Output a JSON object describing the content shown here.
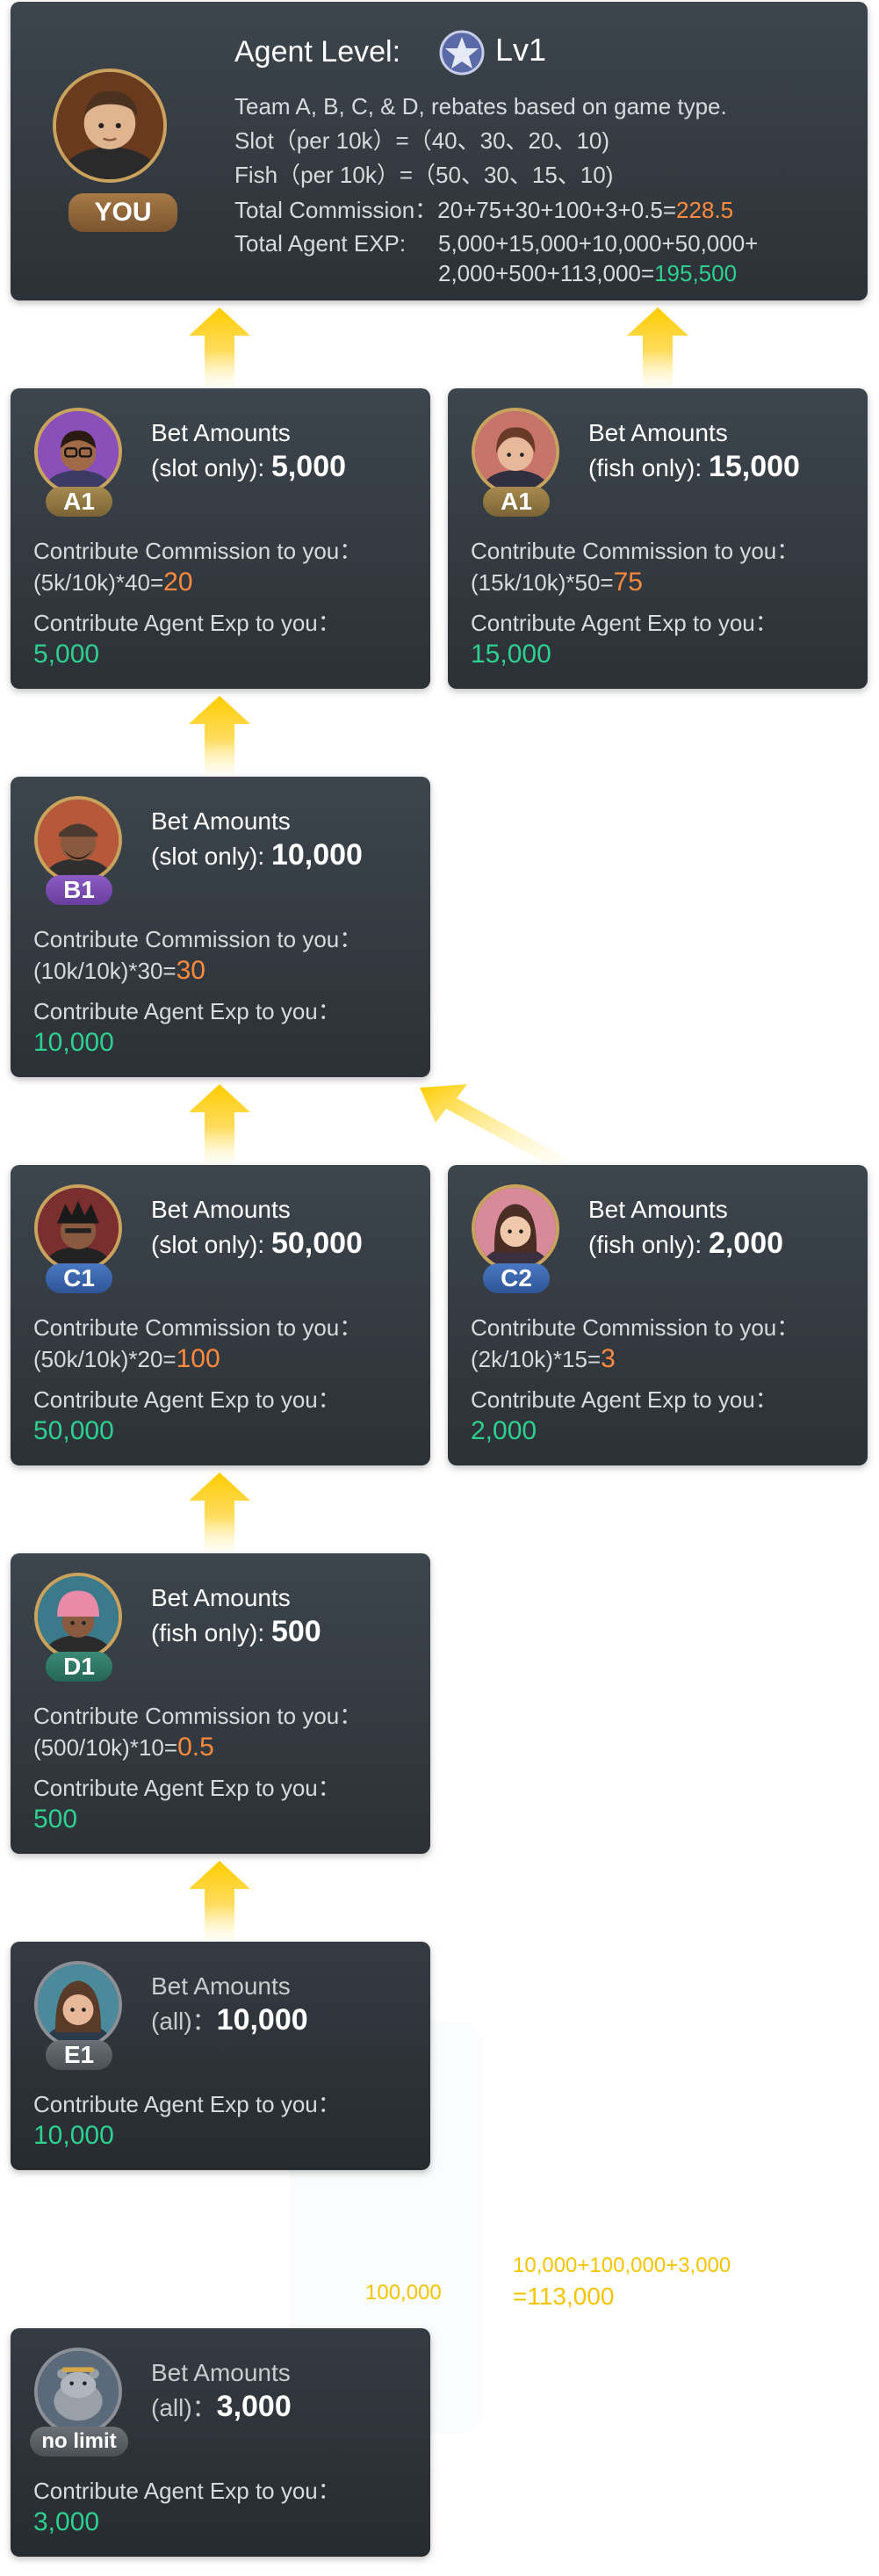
{
  "top": {
    "avatar_badge": "YOU",
    "agent_level_label": "Agent Level:",
    "level": "Lv1",
    "lines": [
      "Team A, B, C, & D, rebates based on game type.",
      "Slot（per 10k）=（40、30、20、10)",
      "Fish（per 10k）=（50、30、15、10)"
    ],
    "commission_label": "Total Commission：",
    "commission_formula": "20+75+30+100+3+0.5=",
    "commission_total": "228.5",
    "exp_label": "Total Agent EXP:",
    "exp_formula_1": "5,000+15,000+10,000+50,000+",
    "exp_formula_2": "2,000+500+113,000=",
    "exp_total": "195,500"
  },
  "cards": {
    "a1_slot": {
      "badge": "A1",
      "bet_label_1": "Bet Amounts",
      "bet_label_2": "(slot only):",
      "bet_value": "5,000",
      "commission_label": "Contribute Commission to you：",
      "commission_formula": "(5k/10k)*40=",
      "commission_value": "20",
      "exp_label": "Contribute Agent Exp to you：",
      "exp_value": "5,000"
    },
    "a1_fish": {
      "badge": "A1",
      "bet_label_1": "Bet Amounts",
      "bet_label_2": "(fish only):",
      "bet_value": "15,000",
      "commission_label": "Contribute Commission to you：",
      "commission_formula": "(15k/10k)*50=",
      "commission_value": "75",
      "exp_label": "Contribute Agent Exp to you：",
      "exp_value": "15,000"
    },
    "b1": {
      "badge": "B1",
      "bet_label_1": "Bet Amounts",
      "bet_label_2": "(slot only):",
      "bet_value": "10,000",
      "commission_label": "Contribute Commission to you：",
      "commission_formula": "(10k/10k)*30=",
      "commission_value": "30",
      "exp_label": "Contribute Agent Exp to you：",
      "exp_value": "10,000"
    },
    "c1": {
      "badge": "C1",
      "bet_label_1": "Bet Amounts",
      "bet_label_2": "(slot only):",
      "bet_value": "50,000",
      "commission_label": "Contribute Commission to you：",
      "commission_formula": "(50k/10k)*20=",
      "commission_value": "100",
      "exp_label": "Contribute Agent Exp to you：",
      "exp_value": "50,000"
    },
    "c2": {
      "badge": "C2",
      "bet_label_1": "Bet Amounts",
      "bet_label_2": "(fish only):",
      "bet_value": "2,000",
      "commission_label": "Contribute Commission to you：",
      "commission_formula": "(2k/10k)*15=",
      "commission_value": "3",
      "exp_label": "Contribute Agent Exp to you：",
      "exp_value": "2,000"
    },
    "d1": {
      "badge": "D1",
      "bet_label_1": "Bet Amounts",
      "bet_label_2": "(fish only):",
      "bet_value": "500",
      "commission_label": "Contribute Commission to you：",
      "commission_formula": "(500/10k)*10=",
      "commission_value": "0.5",
      "exp_label": "Contribute Agent Exp to you：",
      "exp_value": "500"
    },
    "e1": {
      "badge": "E1",
      "bet_label_1": "Bet Amounts",
      "bet_label_2": "(all)：",
      "bet_value": "10,000",
      "exp_label": "Contribute Agent Exp to you：",
      "exp_value": "10,000"
    },
    "no_limit": {
      "badge": "no limit",
      "bet_label_1": "Bet Amounts",
      "bet_label_2": "(all)：",
      "bet_value": "3,000",
      "exp_label": "Contribute Agent Exp to you：",
      "exp_value": "3,000"
    }
  },
  "side_notes": {
    "left": "100,000",
    "right_1": "10,000+100,000+3,000",
    "right_2": "=113,000"
  },
  "colors": {
    "orange": "#ff8a3d",
    "green": "#2ed08f",
    "yellow": "#f5c400"
  }
}
